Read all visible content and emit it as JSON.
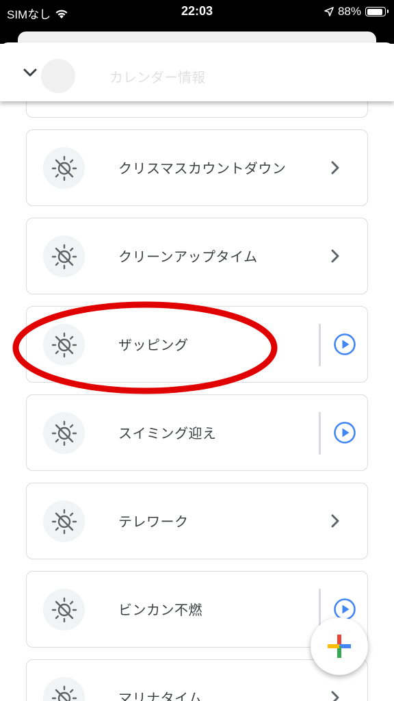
{
  "status_bar": {
    "carrier": "SIMなし",
    "time": "22:03",
    "battery": "88%",
    "battery_level": 0.88
  },
  "header": {
    "collapse_icon": "chevron-down-icon",
    "ghost_title": "カレンダー情報"
  },
  "colors": {
    "accent_blue": "#4285f4",
    "annotation_red": "#e10000",
    "card_border": "#dadce0",
    "icon_bg": "#f1f3f4"
  },
  "routines": [
    {
      "title": "クリスマスカウントダウン",
      "action": "chevron"
    },
    {
      "title": "クリーンアップタイム",
      "action": "chevron"
    },
    {
      "title": "ザッピング",
      "action": "play"
    },
    {
      "title": "スイミング迎え",
      "action": "play"
    },
    {
      "title": "テレワーク",
      "action": "chevron"
    },
    {
      "title": "ビンカン不燃",
      "action": "play"
    },
    {
      "title": "マリナタイム",
      "action": "chevron"
    }
  ],
  "fab": {
    "icon": "google-plus-icon"
  }
}
